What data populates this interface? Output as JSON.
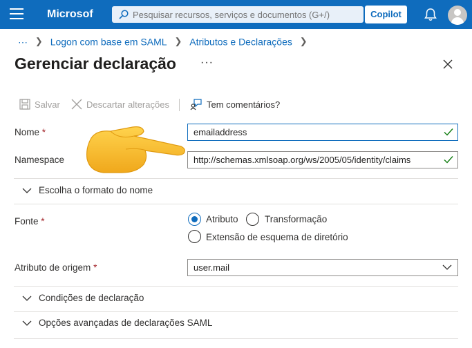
{
  "topbar": {
    "brand": "Microsof",
    "search_placeholder": "Pesquisar recursos, serviços e documentos (G+/)",
    "copilot_label": "Copilot",
    "accent": "#0f6cbd"
  },
  "breadcrumb": {
    "more": "···",
    "items": [
      "Logon com base em SAML",
      "Atributos e Declarações"
    ]
  },
  "page": {
    "title": "Gerenciar declaração",
    "more": "···"
  },
  "toolbar": {
    "save_label": "Salvar",
    "discard_label": "Descartar alterações",
    "feedback_label": "Tem comentários?"
  },
  "form": {
    "name_label": "Nome",
    "name_value": "emailaddress",
    "namespace_label": "Namespace",
    "namespace_value": "http://schemas.xmlsoap.org/ws/2005/05/identity/claims",
    "required_mark": "*",
    "name_format_section": "Escolha o formato do nome",
    "source_label": "Fonte",
    "source_options": [
      "Atributo",
      "Transformação",
      "Extensão de esquema de diretório"
    ],
    "source_selected": "Atributo",
    "source_attribute_label": "Atributo de origem",
    "source_attribute_value": "user.mail",
    "claim_conditions_section": "Condições de declaração",
    "advanced_section": "Opções avançadas de declarações SAML"
  },
  "icons": {
    "hamburger": "hamburger-icon",
    "search": "search-icon",
    "bell": "bell-icon",
    "avatar": "avatar-icon",
    "close": "close-icon",
    "save": "save-icon",
    "discard": "close-icon",
    "feedback": "feedback-icon",
    "check": "check-icon",
    "chevron": "chevron-down-icon",
    "pointer": "pointing-hand-icon"
  }
}
